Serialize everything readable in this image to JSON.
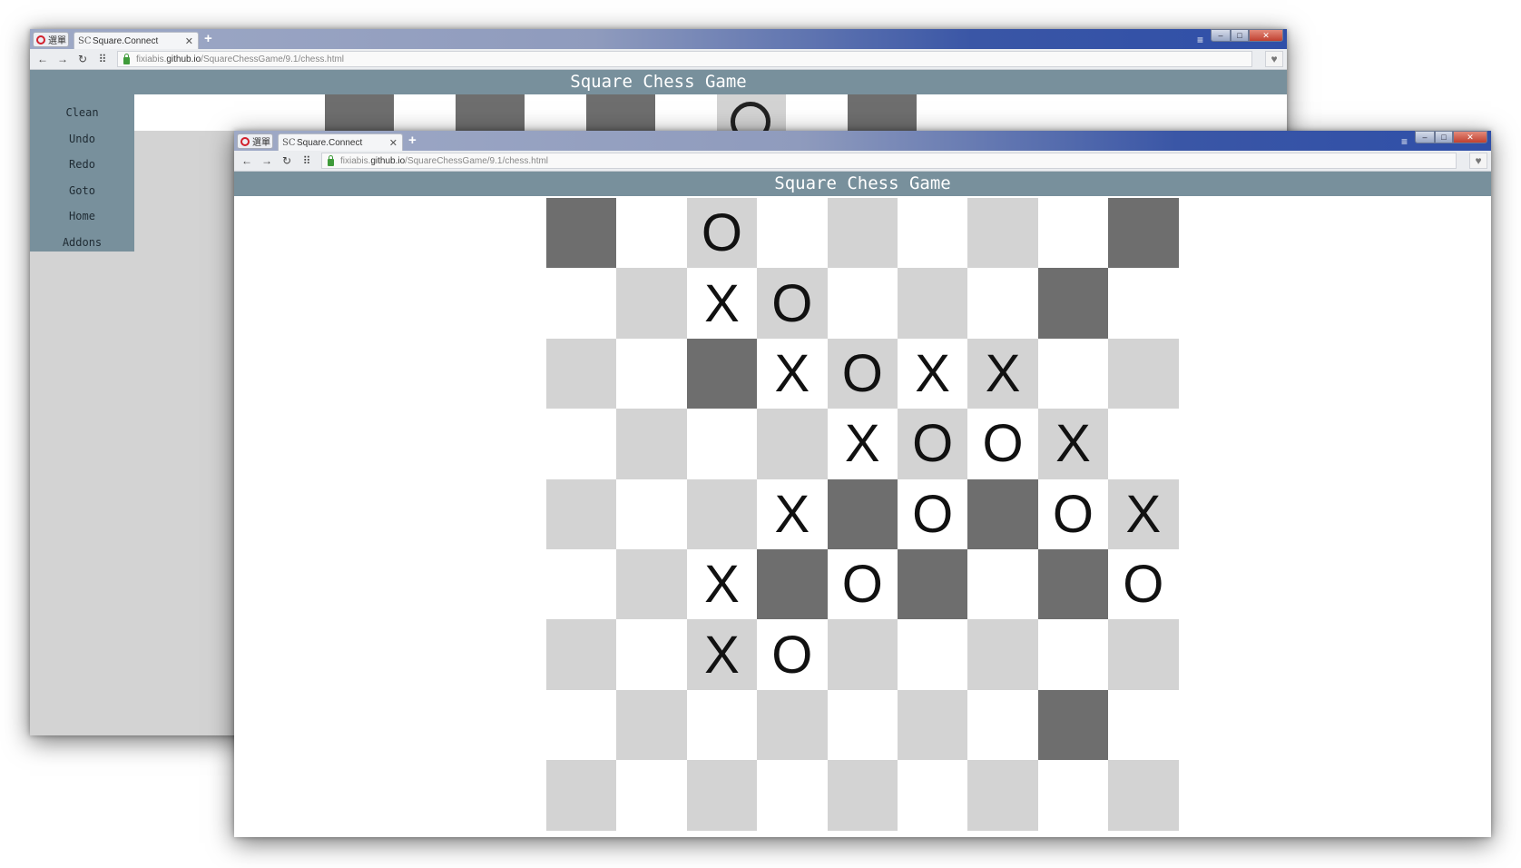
{
  "browser": {
    "menu_label": "選單",
    "tab_label": "Square.Connect",
    "tab_icon": "SC",
    "url_host_prefix": "fixiabis.",
    "url_host": "github.io",
    "url_path": "/SquareChessGame/9.1/chess.html"
  },
  "app": {
    "title": "Square Chess Game"
  },
  "sidebar": {
    "items": [
      "Clean",
      "Undo",
      "Redo",
      "Goto",
      "Home",
      "Addons"
    ]
  },
  "board": {
    "size": 9,
    "colors": {
      "light": "#d3d3d3",
      "white": "#ffffff",
      "dark": "#6e6e6e",
      "header": "#78909c"
    },
    "cells": [
      [
        "d",
        "w",
        "l",
        "w",
        "l",
        "w",
        "l",
        "w",
        "d"
      ],
      [
        "w",
        "l",
        "w",
        "l",
        "w",
        "l",
        "w",
        "d",
        "w"
      ],
      [
        "l",
        "w",
        "d",
        "w",
        "l",
        "w",
        "l",
        "w",
        "l"
      ],
      [
        "w",
        "l",
        "w",
        "l",
        "w",
        "l",
        "w",
        "l",
        "w"
      ],
      [
        "l",
        "w",
        "l",
        "w",
        "d",
        "w",
        "d",
        "w",
        "l"
      ],
      [
        "w",
        "l",
        "w",
        "d",
        "w",
        "d",
        "w",
        "d",
        "w"
      ],
      [
        "l",
        "w",
        "l",
        "w",
        "l",
        "w",
        "l",
        "w",
        "l"
      ],
      [
        "w",
        "l",
        "w",
        "l",
        "w",
        "l",
        "w",
        "d",
        "w"
      ],
      [
        "l",
        "w",
        "l",
        "w",
        "l",
        "w",
        "l",
        "w",
        "l"
      ]
    ],
    "pieces": [
      [
        "",
        "",
        "O",
        "",
        "",
        "",
        "",
        "",
        ""
      ],
      [
        "",
        "",
        "X",
        "O",
        "",
        "",
        "",
        "",
        ""
      ],
      [
        "",
        "",
        "",
        "X",
        "O",
        "X",
        "X",
        "",
        ""
      ],
      [
        "",
        "",
        "",
        "",
        "X",
        "O",
        "O",
        "X",
        ""
      ],
      [
        "",
        "",
        "",
        "X",
        "",
        "O",
        "",
        "O",
        "X"
      ],
      [
        "",
        "",
        "X",
        "",
        "O",
        "",
        "",
        "",
        "O"
      ],
      [
        "",
        "",
        "X",
        "O",
        "",
        "",
        "",
        "",
        ""
      ],
      [
        "",
        "",
        "",
        "",
        "",
        "",
        "",
        "",
        ""
      ],
      [
        "",
        "",
        "",
        "",
        "",
        "",
        "",
        "",
        ""
      ]
    ],
    "back_window_row0_piece": "O"
  }
}
